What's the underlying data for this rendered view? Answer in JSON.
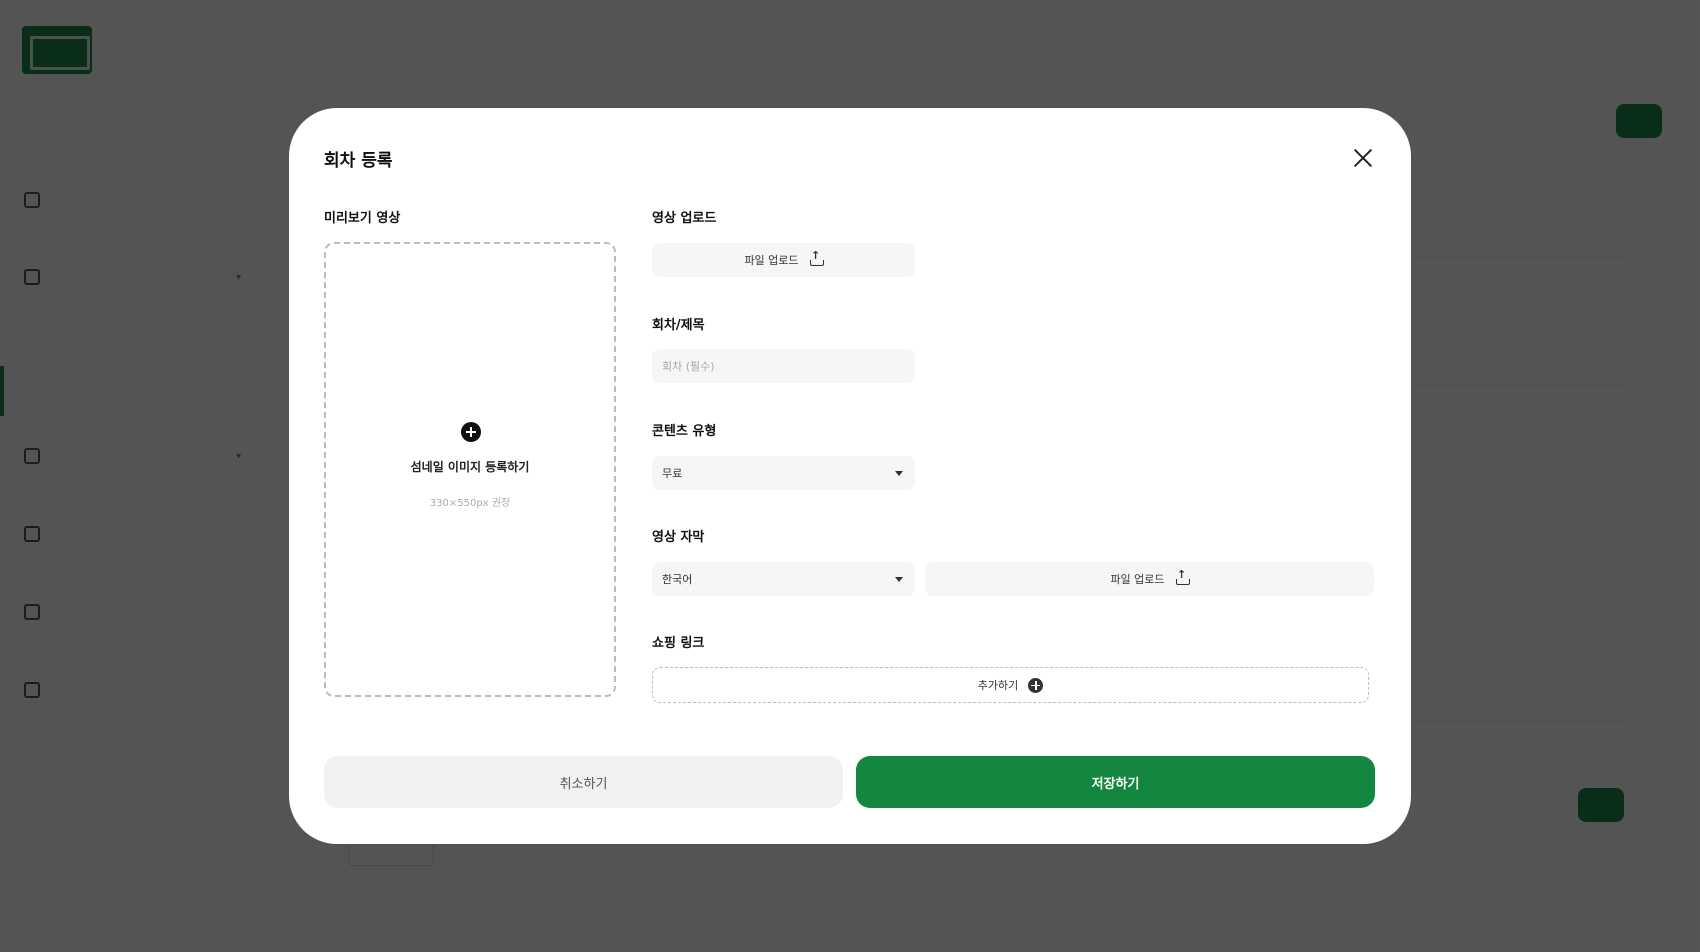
{
  "modal": {
    "title": "회차 등록",
    "preview": {
      "label": "미리보기 영상",
      "main_text": "섬네일 이미지 등록하기",
      "sub_text": "330×550px 권장"
    },
    "video_upload": {
      "label": "영상 업로드",
      "button": "파일 업로드"
    },
    "episode_title": {
      "label": "회차/제목",
      "placeholder": "회차 (필수)"
    },
    "content_type": {
      "label": "콘텐츠 유형",
      "selected": "무료"
    },
    "subtitle": {
      "label": "영상 자막",
      "selected": "한국어",
      "button": "파일 업로드"
    },
    "shopping_link": {
      "label": "쇼핑 링크",
      "add_button": "추가하기"
    },
    "cancel_label": "취소하기",
    "save_label": "저장하기"
  },
  "colors": {
    "accent": "#13873f",
    "overlay": "rgba(0,0,0,0.67)"
  }
}
